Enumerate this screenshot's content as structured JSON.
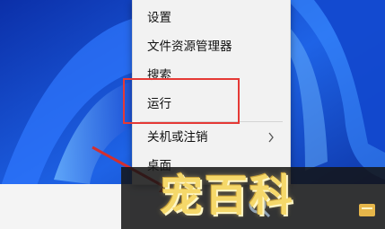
{
  "context_menu": {
    "items": [
      {
        "label": "设置"
      },
      {
        "label": "文件资源管理器"
      },
      {
        "label": "搜索"
      },
      {
        "label": "运行"
      },
      {
        "label": "关机或注销",
        "has_submenu": true
      },
      {
        "label": "桌面"
      }
    ]
  },
  "watermark": {
    "text": "宠百科"
  },
  "colors": {
    "highlight_box": "#e53935",
    "arrow": "#d32f2f",
    "menu_bg": "#f2f2f2",
    "wallpaper_blue": "#1a5ae0"
  },
  "icons": [
    "chevron-right-icon",
    "search-icon",
    "app-icon"
  ]
}
